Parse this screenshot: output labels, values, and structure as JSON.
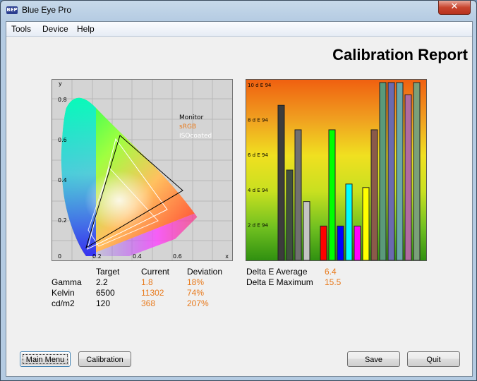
{
  "window": {
    "title": "Blue Eye Pro",
    "icon_text": "BEP",
    "close_label": "✕"
  },
  "menu": {
    "items": [
      "Tools",
      "Device",
      "Help"
    ]
  },
  "report": {
    "title": "Calibration Report"
  },
  "cie": {
    "y_label": "y",
    "x_label": "x",
    "y_ticks": [
      "0.8",
      "0.6",
      "0.4",
      "0.2",
      "0"
    ],
    "x_ticks": [
      "0.2",
      "0.4",
      "0.6"
    ],
    "legend": [
      {
        "label": "Monitor",
        "color": "#000000"
      },
      {
        "label": "sRGB",
        "color": "#e87a1c"
      },
      {
        "label": "ISOcoated",
        "color": "#ffffff"
      }
    ]
  },
  "chart_data": {
    "type": "bar",
    "y_ticks": [
      "10 d E 94",
      "8 d E 94",
      "6 d E 94",
      "4 d E 94",
      "2 d E 94"
    ],
    "ylim": [
      0,
      10
    ],
    "values": [
      8.7,
      5.0,
      7.3,
      3.2,
      0,
      1.8,
      7.3,
      1.8,
      4.2,
      1.8,
      4.0,
      7.3,
      10,
      10,
      10,
      9.3,
      10
    ],
    "colors": [
      "#3c3c3c",
      "#404f40",
      "#707070",
      "#c4c4c4",
      "",
      "#ff0000",
      "#00ff00",
      "#0000ff",
      "#00ffff",
      "#ff00ff",
      "#ffff00",
      "#8a5a4a",
      "#5a9a7a",
      "#6a6ab0",
      "#6aa8a8",
      "#b06aa0",
      "#7aa07a"
    ]
  },
  "stats": {
    "headers": [
      "Target",
      "Current",
      "Deviation"
    ],
    "rows": [
      {
        "label": "Gamma",
        "target": "2.2",
        "current": "1.8",
        "deviation": "18%"
      },
      {
        "label": "Kelvin",
        "target": "6500",
        "current": "11302",
        "deviation": "74%"
      },
      {
        "label": "cd/m2",
        "target": "120",
        "current": "368",
        "deviation": "207%"
      }
    ]
  },
  "delta": {
    "avg_label": "Delta E Average",
    "avg_value": "6.4",
    "max_label": "Delta E Maximum",
    "max_value": "15.5"
  },
  "buttons": {
    "main_menu": "Main Menu",
    "calibration": "Calibration",
    "save": "Save",
    "quit": "Quit"
  }
}
